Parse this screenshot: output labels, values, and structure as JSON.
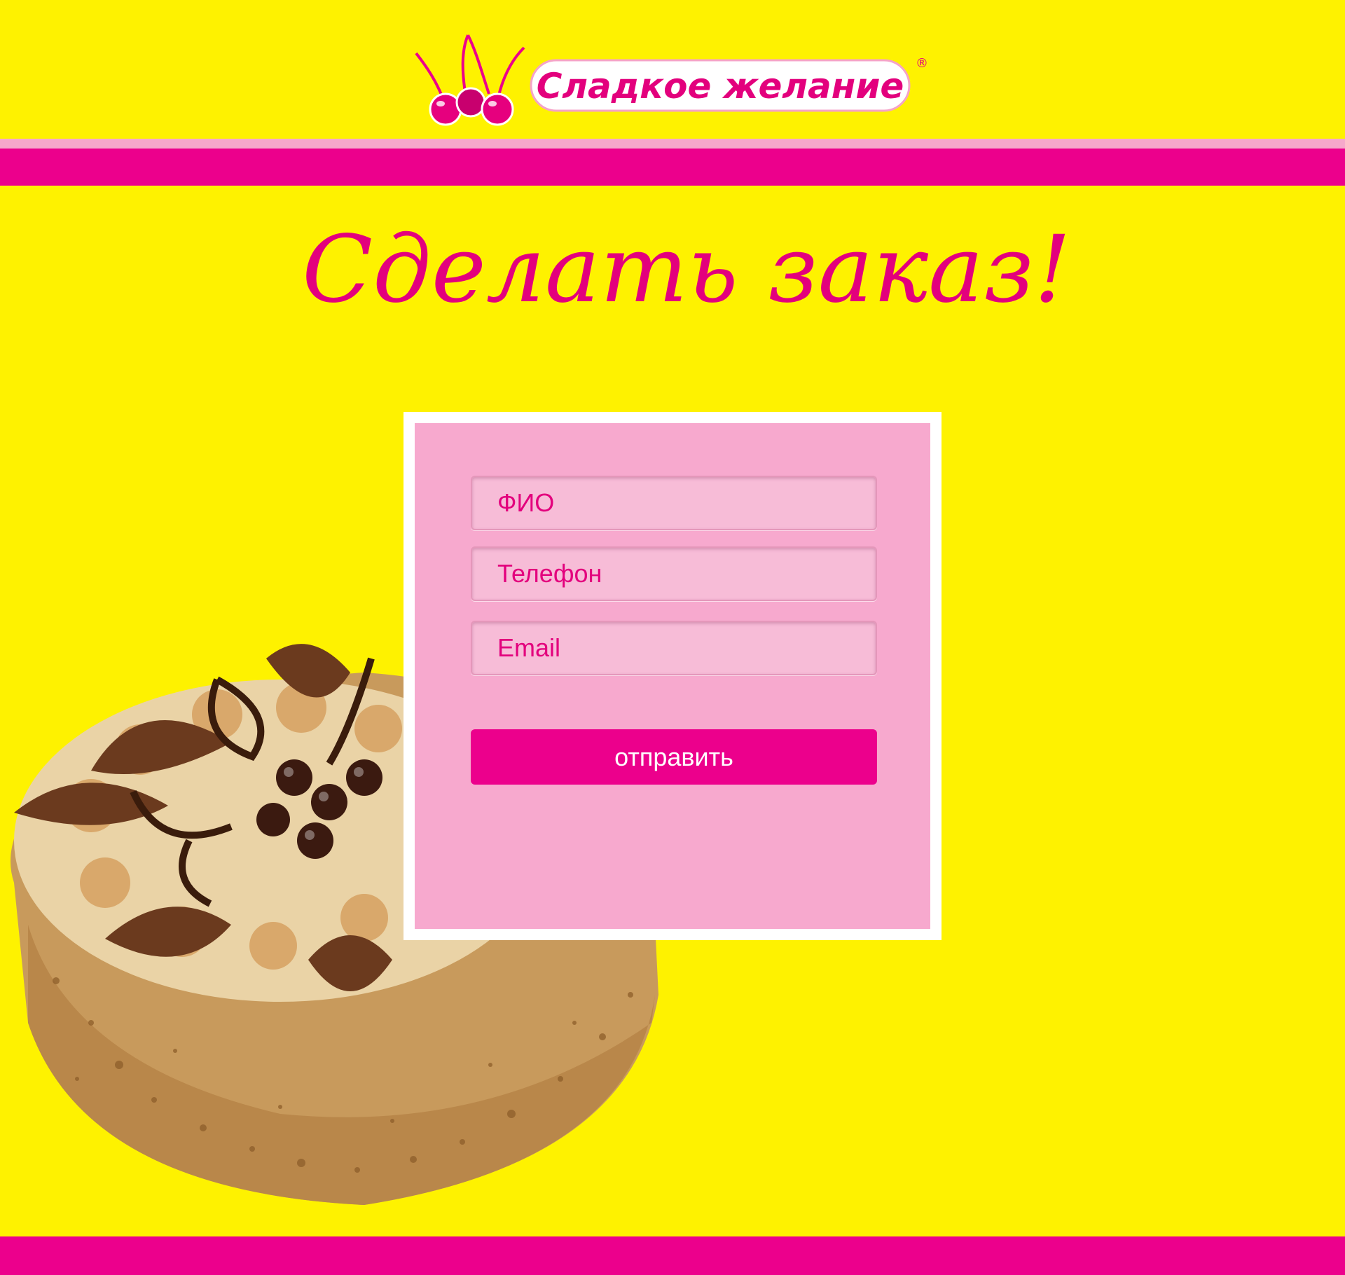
{
  "brand": {
    "logo_text": "Сладкое желание",
    "registered_mark": "®"
  },
  "headline": "Сделать заказ!",
  "form": {
    "fields": [
      {
        "placeholder": "ФИО"
      },
      {
        "placeholder": "Телефон"
      },
      {
        "placeholder": "Email"
      }
    ],
    "submit_label": "отправить"
  },
  "colors": {
    "background": "#FEF200",
    "accent_magenta": "#EC008C",
    "light_pink": "#F7A9CE",
    "field_pink": "#F7BCD7"
  },
  "icons": {
    "logo_icon": "cherries-icon",
    "decorative_image": "cake-image"
  }
}
